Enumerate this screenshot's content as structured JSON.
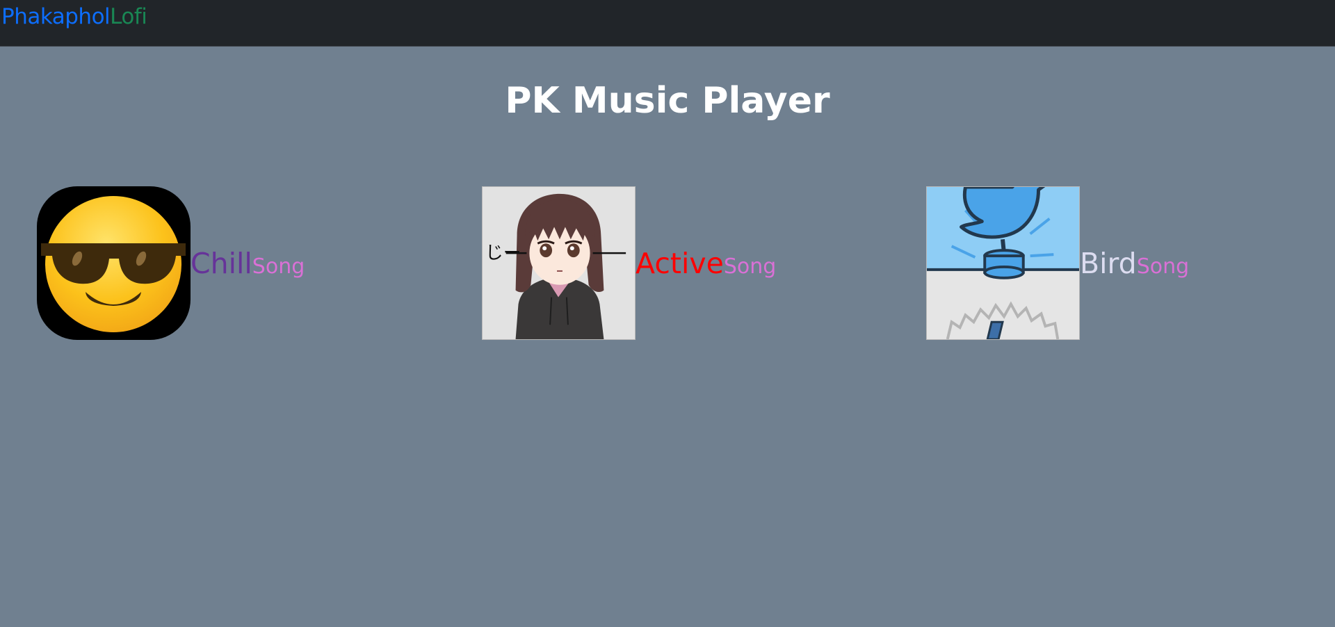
{
  "navbar": {
    "brand_first": "Phakaphol",
    "brand_second": "Lofi",
    "brand_first_color": "#0d6efd",
    "brand_second_color": "#198754"
  },
  "main": {
    "title": "PK Music Player"
  },
  "songs": [
    {
      "icon": "sunglasses-emoji-icon",
      "name": "Chill",
      "suffix": "Song",
      "name_color": "#663399",
      "suffix_color": "#da70d6"
    },
    {
      "icon": "anime-girl-hoodie-icon",
      "name": "Active",
      "suffix": "Song",
      "name_color": "#ff0000",
      "suffix_color": "#da70d6"
    },
    {
      "icon": "twitter-bird-icon",
      "name": "Bird",
      "suffix": "Song",
      "name_color": "#dcdcf0",
      "suffix_color": "#da70d6"
    }
  ],
  "cover_texts": {
    "anime_glyph": "じー"
  }
}
